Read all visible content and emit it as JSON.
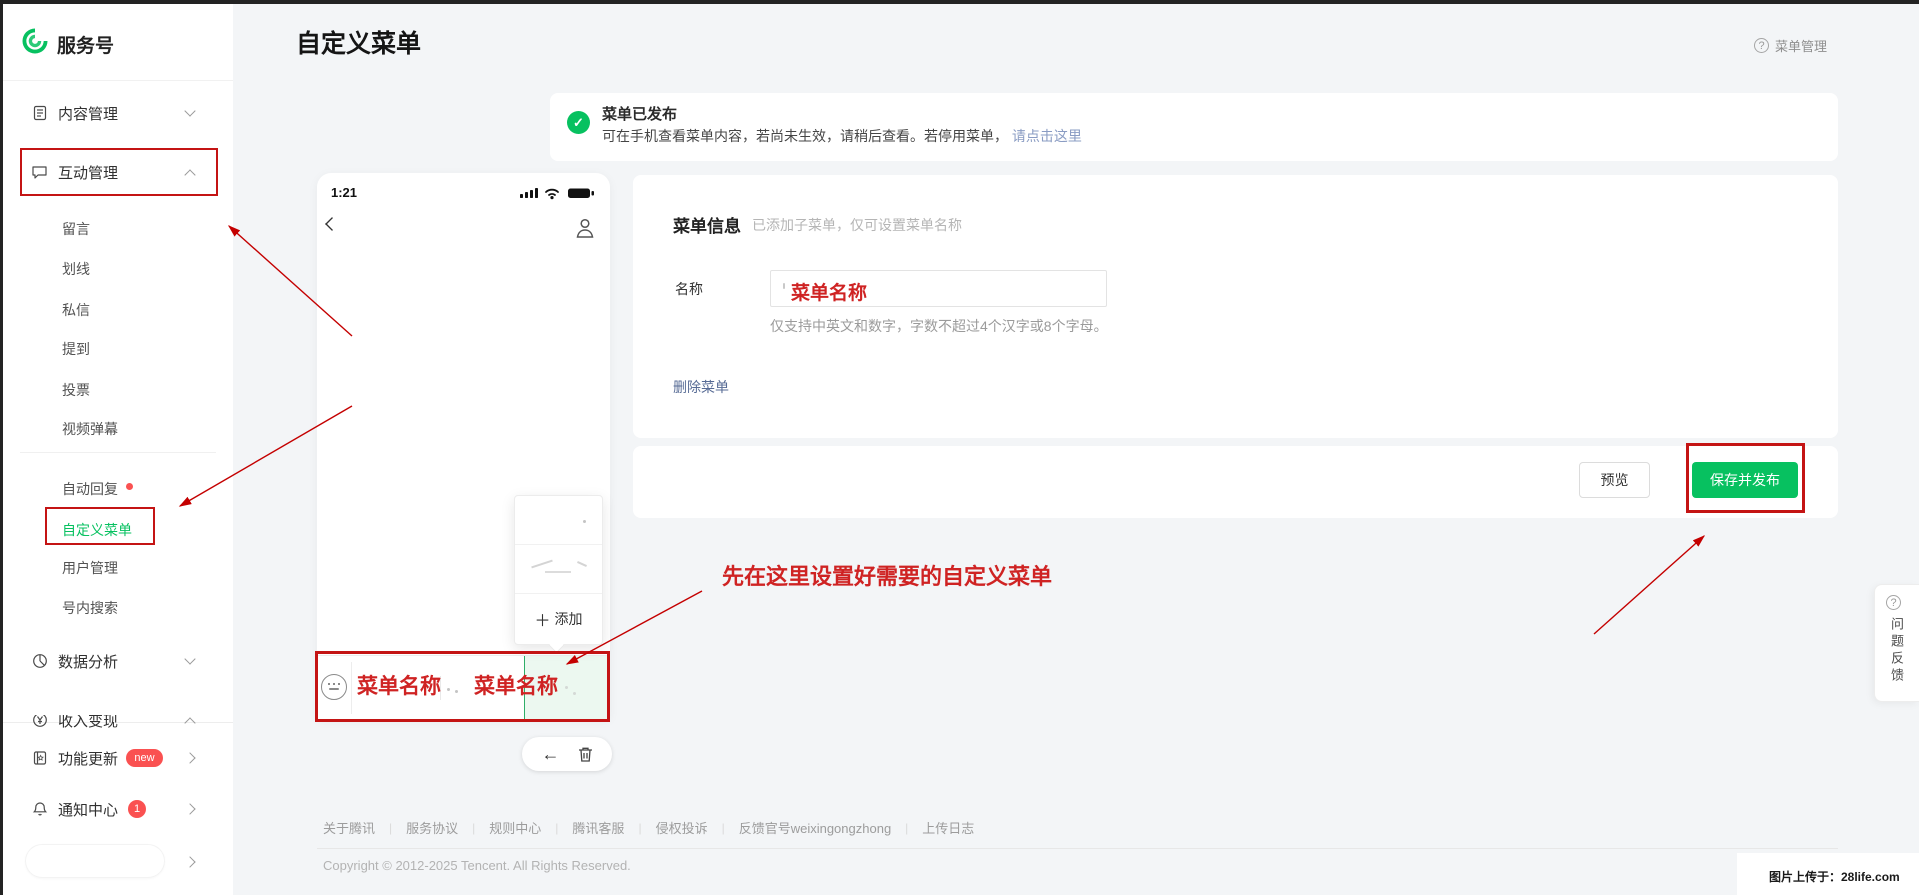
{
  "header": {
    "title": "自定义菜单",
    "help_label": "菜单管理"
  },
  "sidebar": {
    "logo_text": "服务号",
    "items": [
      {
        "label": "内容管理"
      },
      {
        "label": "互动管理"
      },
      {
        "label": "数据分析"
      },
      {
        "label": "收入变现"
      },
      {
        "label": "功能更新",
        "badge": "new"
      },
      {
        "label": "通知中心",
        "badge": "1"
      }
    ],
    "sub_items": [
      "留言",
      "划线",
      "私信",
      "提到",
      "投票",
      "视频弹幕",
      "自动回复",
      "自定义菜单",
      "用户管理",
      "号内搜索"
    ]
  },
  "banner": {
    "title": "菜单已发布",
    "desc": "可在手机查看菜单内容，若尚未生效，请稍后查看。若停用菜单，",
    "link_label": "请点击这里"
  },
  "phone": {
    "time": "1:21",
    "add_label": "添加",
    "menu_labels": [
      "菜单名称",
      "菜单名称"
    ]
  },
  "form": {
    "section_title": "菜单信息",
    "section_note": "已添加子菜单，仅可设置菜单名称",
    "name_label": "名称",
    "name_value": "菜单名称",
    "name_hint": "仅支持中英文和数字，字数不超过4个汉字或8个字母。",
    "delete_link": "删除菜单"
  },
  "actions": {
    "preview_label": "预览",
    "save_label": "保存并发布"
  },
  "annotation": {
    "tip_text": "先在这里设置好需要的自定义菜单"
  },
  "page_footer": {
    "links": [
      "关于腾讯",
      "服务协议",
      "规则中心",
      "腾讯客服",
      "侵权投诉",
      "反馈官号weixingongzhong",
      "上传日志"
    ],
    "copyright": "Copyright © 2012-2025 Tencent. All Rights Reserved."
  },
  "feedback_tab": {
    "label": "问题反馈"
  },
  "watermark": {
    "text": "图片上传于：28life.com"
  },
  "icons": {
    "question": "?",
    "plus": "＋",
    "check": "✓",
    "back_arrow": "←",
    "chevron_left": "‹"
  },
  "colors": {
    "accent_green": "#07c160",
    "annotation_red": "#c41414",
    "badge_red": "#fa5151",
    "link_blue": "#576b95"
  }
}
